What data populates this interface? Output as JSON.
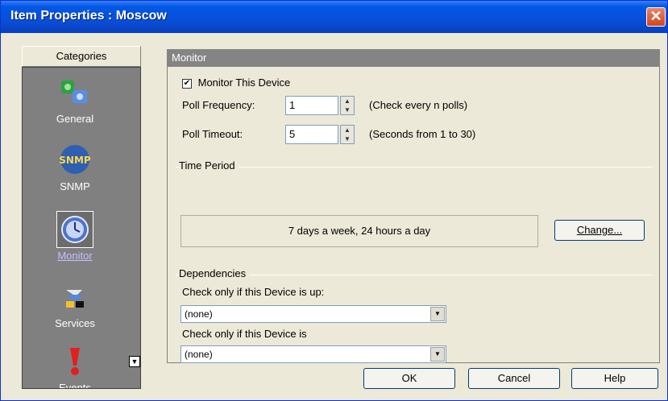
{
  "window": {
    "title": "Item Properties : Moscow",
    "close_symbol": "✕"
  },
  "categories": {
    "header": "Categories",
    "items": [
      {
        "label": "General",
        "icon": "general-icon"
      },
      {
        "label": "SNMP",
        "icon": "snmp-icon",
        "icon_text": "SNMP"
      },
      {
        "label": "Monitor",
        "icon": "clock-icon",
        "selected": true
      },
      {
        "label": "Services",
        "icon": "services-icon"
      },
      {
        "label": "Events",
        "icon": "events-icon"
      }
    ]
  },
  "monitor": {
    "header": "Monitor",
    "monitor_device_label": "Monitor This Device",
    "monitor_device_checked": true,
    "poll_frequency_label": "Poll Frequency:",
    "poll_frequency_value": "1",
    "poll_frequency_hint": "(Check every n polls)",
    "poll_timeout_label": "Poll Timeout:",
    "poll_timeout_value": "5",
    "poll_timeout_hint": "(Seconds from 1 to 30)",
    "time_period_label": "Time Period",
    "time_period_value": "7 days a week, 24 hours a day",
    "change_button": "Change...",
    "dependencies_label": "Dependencies",
    "dep_up_label": "Check only if this Device is up:",
    "dep_up_value": "(none)",
    "dep_is_label": "Check only if this Device is",
    "dep_is_value": "(none)"
  },
  "buttons": {
    "ok": "OK",
    "cancel": "Cancel",
    "help": "Help"
  },
  "colors": {
    "titlebar": "#0a4fd8",
    "category_panel": "#808080",
    "panel_header": "#848484"
  }
}
